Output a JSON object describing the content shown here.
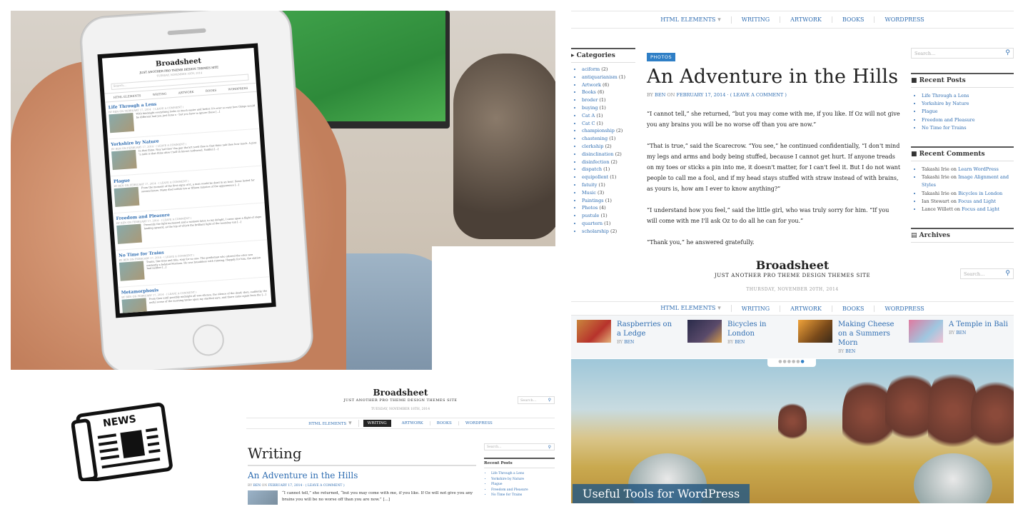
{
  "phone": {
    "brand": "Broadsheet",
    "tagline": "JUST ANOTHER PRO THEME DESIGN THEMES SITE",
    "date": "TUESDAY, NOVEMBER 18TH, 2014",
    "search_placeholder": "Search...",
    "nav": [
      "HTML ELEMENTS",
      "WRITING",
      "ARTWORK",
      "BOOKS",
      "WORDPRESS"
    ],
    "posts": [
      {
        "title": "Life Through a Lens",
        "meta": "BY BEN ON FEBRUARY 17, 2014 · ( LEAVE A COMMENT )",
        "excerpt": "With hindsight everything looks so much easier and better. It's ever so easy how things would be different had you just done x - but you have to ignore these [...]"
      },
      {
        "title": "Yorkshire by Nature",
        "meta": "BY BEN ON FEBRUARY 17, 2014 · ( LEAVE A COMMENT )",
        "excerpt": "In that thine. Nay lad thee' tha gan tha'art noeh thee is that thine nah thee how much. A pint 'n mild is that thine ahre t'nell th knows nothwsed. Nobbut [...]"
      },
      {
        "title": "Plague",
        "meta": "BY BEN ON FEBRUARY 17, 2014 · ( LEAVE A COMMENT )",
        "excerpt": "From the moment of the first signs of it, a man would be dead in an hour. Some lasted for several hours. Many died within ten or fifteen minutes of the appearance [...]"
      },
      {
        "title": "Freedom and Pleasure",
        "meta": "BY BEN ON FEBRUARY 17, 2014 · ( LEAVE A COMMENT )",
        "excerpt": "Presently the light increased and a moment later, to my delight, I came upon a flight of steps leading upward, at the top of which the brilliant light of the noonday sun [...]"
      },
      {
        "title": "No Time for Trains",
        "meta": "BY BEN ON FEBRUARY 17, 2014 · ( LEAVE A COMMENT )",
        "excerpt": "Trains, like time and tide, stop for no one. The gentleman who uttered the cries was evidently a belated Mormon. He was breathless with running. Happily for him, the station had neither [...]"
      },
      {
        "title": "Metamorphosis",
        "meta": "BY BEN ON FEBRUARY 17, 2014 · ( LEAVE A COMMENT )",
        "excerpt": "From then until possibly midnight all was silence, the silence of the dead; then, suddenly, the awful scene of the morning broke upon my startled ears, and there came again from the [...]"
      }
    ]
  },
  "single": {
    "nav": [
      "HTML ELEMENTS",
      "WRITING",
      "ARTWORK",
      "BOOKS",
      "WORDPRESS"
    ],
    "categories_title": "Categories",
    "categories": [
      {
        "name": "aciform",
        "count": "(2)"
      },
      {
        "name": "antiquarianism",
        "count": "(1)"
      },
      {
        "name": "Artwork",
        "count": "(6)"
      },
      {
        "name": "Books",
        "count": "(6)"
      },
      {
        "name": "broder",
        "count": "(1)"
      },
      {
        "name": "buying",
        "count": "(1)"
      },
      {
        "name": "Cat A",
        "count": "(1)"
      },
      {
        "name": "Cat C",
        "count": "(1)"
      },
      {
        "name": "championship",
        "count": "(2)"
      },
      {
        "name": "chastening",
        "count": "(1)"
      },
      {
        "name": "clerkship",
        "count": "(2)"
      },
      {
        "name": "disinclination",
        "count": "(2)"
      },
      {
        "name": "disinfection",
        "count": "(2)"
      },
      {
        "name": "dispatch",
        "count": "(1)"
      },
      {
        "name": "equipollent",
        "count": "(1)"
      },
      {
        "name": "fatuity",
        "count": "(1)"
      },
      {
        "name": "Music",
        "count": "(3)"
      },
      {
        "name": "Paintings",
        "count": "(1)"
      },
      {
        "name": "Photos",
        "count": "(4)"
      },
      {
        "name": "pustule",
        "count": "(1)"
      },
      {
        "name": "quartern",
        "count": "(1)"
      },
      {
        "name": "scholarship",
        "count": "(2)"
      }
    ],
    "tag": "PHOTOS",
    "title": "An Adventure in the Hills",
    "meta_by": "BY",
    "meta_author": "BEN",
    "meta_on": "ON",
    "meta_date": "FEBRUARY 17, 2014",
    "meta_comment": "· ( LEAVE A COMMENT )",
    "paragraphs": [
      "“I cannot tell,” she returned, “but you may come with me, if you like. If Oz will not give you any brains you will be no worse off than you are now.”",
      "“That is true,” said the Scarecrow. “You see,” he continued confidentially, “I don't mind my legs and arms and body being stuffed, because I cannot get hurt. If anyone treads on my toes or sticks a pin into me, it doesn't matter, for I can't feel it. But I do not want people to call me a fool, and if my head stays stuffed with straw instead of with brains, as yours is, how am I ever to know anything?”",
      "“I understand how you feel,” said the little girl, who was truly sorry for him. “If you will come with me I'll ask Oz to do all he can for you.”",
      "“Thank you,” he answered gratefully."
    ],
    "search_placeholder": "Search...",
    "recent_posts_title": "Recent Posts",
    "recent_posts": [
      "Life Through a Lens",
      "Yorkshire by Nature",
      "Plague",
      "Freedom and Pleasure",
      "No Time for Trains"
    ],
    "recent_comments_title": "Recent Comments",
    "recent_comments": [
      {
        "author": "Takashi Irie",
        "on": "on",
        "post": "Learn WordPress"
      },
      {
        "author": "Takashi Irie",
        "on": "on",
        "post": "Image Alignment and Styles"
      },
      {
        "author": "Takashi Irie",
        "on": "on",
        "post": "Bicycles in London"
      },
      {
        "author": "Ian Stewart",
        "on": "on",
        "post": "Focus and Light"
      },
      {
        "author": "Lance Willett",
        "on": "on",
        "post": "Focus and Light"
      }
    ],
    "archives_title": "Archives"
  },
  "home": {
    "brand": "Broadsheet",
    "tagline": "JUST ANOTHER PRO THEME DESIGN THEMES SITE",
    "date": "THURSDAY, NOVEMBER 20TH, 2014",
    "search_placeholder": "Search...",
    "nav": [
      "HTML ELEMENTS",
      "WRITING",
      "ARTWORK",
      "BOOKS",
      "WORDPRESS"
    ],
    "featured": [
      {
        "title": "Raspberries on a Ledge",
        "by": "BY",
        "author": "BEN"
      },
      {
        "title": "Bicycles in London",
        "by": "BY",
        "author": "BEN"
      },
      {
        "title": "Making Cheese on a Summers Morn",
        "by": "BY",
        "author": "BEN"
      },
      {
        "title": "A Temple in Bali",
        "by": "BY",
        "author": "BEN"
      }
    ],
    "slide_caption": "Useful Tools for WordPress"
  },
  "archive": {
    "brand": "Broadsheet",
    "tagline": "JUST ANOTHER PRO THEME DESIGN THEMES SITE",
    "date": "TUESDAY, NOVEMBER 18TH, 2014",
    "search_placeholder": "Search...",
    "nav": [
      "HTML ELEMENTS",
      "WRITING",
      "ARTWORK",
      "BOOKS",
      "WORDPRESS"
    ],
    "heading": "Writing",
    "post_title": "An Adventure in the Hills",
    "post_meta_by": "BY",
    "post_meta_author": "BEN",
    "post_meta_on": "ON",
    "post_meta_date": "FEBRUARY 17, 2014",
    "post_meta_comment": "· ( LEAVE A COMMENT )",
    "post_excerpt": "“I cannot tell,” she returned, “but you may come with me, if you like. If Oz will not give you any brains you will be no worse off than you are now.” [...]",
    "recent_posts_title": "Recent Posts",
    "recent_posts": [
      "Life Through a Lens",
      "Yorkshire by Nature",
      "Plague",
      "Freedom and Pleasure",
      "No Time for Trains"
    ]
  },
  "news_icon_label": "NEWS",
  "colors": {
    "link": "#2f6db1",
    "accent": "#2f7fc6"
  }
}
